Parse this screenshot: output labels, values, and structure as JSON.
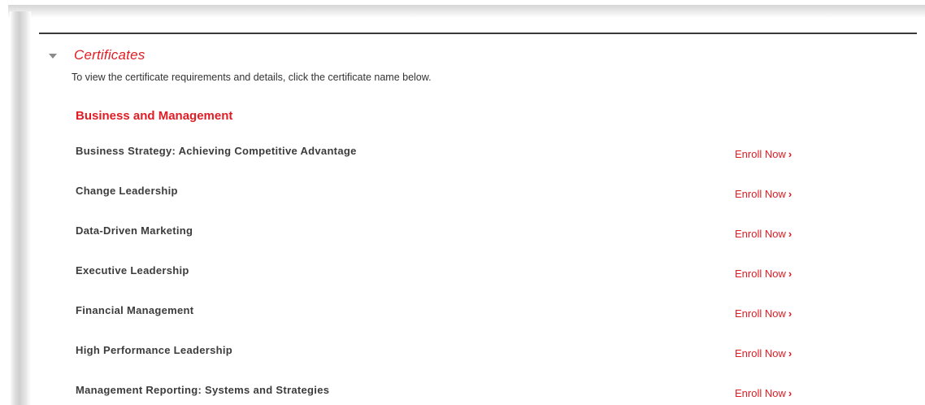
{
  "section": {
    "title": "Certificates",
    "intro": "To view the certificate requirements and details, click the certificate name below."
  },
  "group": {
    "title": "Business and Management"
  },
  "enroll_label": "Enroll Now",
  "enroll_chevron": "›",
  "certificates": [
    {
      "name": "Business Strategy: Achieving Competitive Advantage"
    },
    {
      "name": "Change Leadership"
    },
    {
      "name": "Data-Driven Marketing"
    },
    {
      "name": "Executive Leadership"
    },
    {
      "name": "Financial Management"
    },
    {
      "name": "High Performance Leadership"
    },
    {
      "name": "Management Reporting: Systems and Strategies"
    }
  ],
  "colors": {
    "accent": "#e01c24",
    "text": "#3c3c3c",
    "rule": "#3a3a3a"
  },
  "icons": {
    "collapse": "caret-down-icon",
    "enroll_arrow": "chevron-right-icon"
  }
}
